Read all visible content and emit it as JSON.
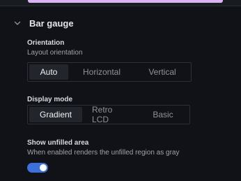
{
  "section": {
    "title": "Bar gauge",
    "icon": "chevron-down-icon"
  },
  "orientation": {
    "label": "Orientation",
    "description": "Layout orientation",
    "options": [
      "Auto",
      "Horizontal",
      "Vertical"
    ],
    "selected": "Auto"
  },
  "display_mode": {
    "label": "Display mode",
    "options": [
      "Gradient",
      "Retro LCD",
      "Basic"
    ],
    "selected": "Gradient"
  },
  "show_unfilled": {
    "label": "Show unfilled area",
    "description": "When enabled renders the unfilled region as gray",
    "enabled": true
  },
  "colors": {
    "toggle_on": "#3d71d9",
    "accent_strip": "#d9b3f2",
    "background": "#111217"
  }
}
